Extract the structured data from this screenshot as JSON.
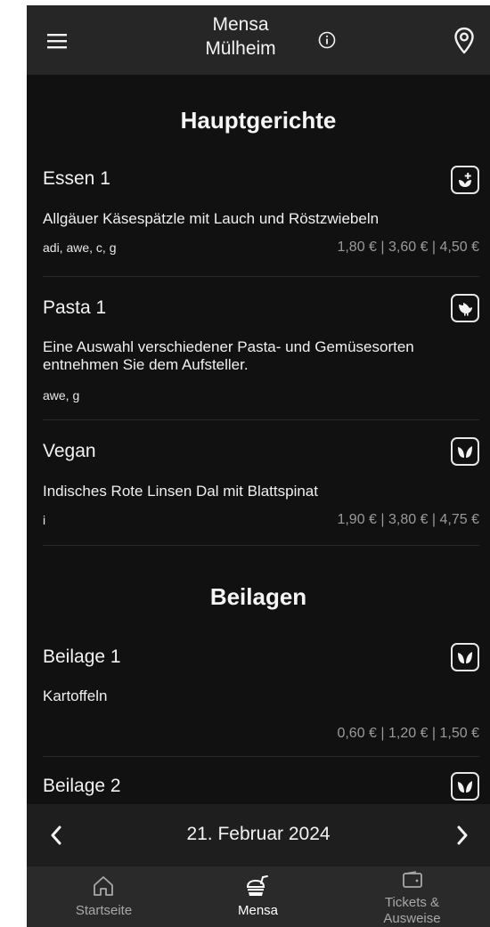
{
  "header": {
    "title_line1": "Mensa",
    "title_line2": "Mülheim",
    "menu_icon": "hamburger-menu-icon",
    "info_icon": "info-icon",
    "location_icon": "location-pin-icon"
  },
  "sections": [
    {
      "title": "Hauptgerichte",
      "meals": [
        {
          "name": "Essen 1",
          "description": "Allgäuer Käsespätzle  mit Lauch und Röstzwiebeln",
          "allergens": "adi, awe, c, g",
          "prices": "1,80 € | 3,60 € | 4,50 €",
          "badge_icon": "vegetarian-icon"
        },
        {
          "name": "Pasta 1",
          "description": "Eine Auswahl verschiedener Pasta- und Gemüsesorten entnehmen Sie dem Aufsteller.",
          "allergens": "awe, g",
          "prices": "",
          "badge_icon": "poultry-icon"
        },
        {
          "name": "Vegan",
          "description": "Indisches Rote Linsen Dal mit Blattspinat",
          "allergens": "i",
          "prices": "1,90 € | 3,80 € | 4,75 €",
          "badge_icon": "vegan-leaf-icon"
        }
      ]
    },
    {
      "title": "Beilagen",
      "meals": [
        {
          "name": "Beilage 1",
          "description": "Kartoffeln",
          "allergens": "",
          "prices": "0,60 € | 1,20 € | 1,50 €",
          "badge_icon": "vegan-leaf-icon"
        },
        {
          "name": "Beilage 2",
          "description": "",
          "allergens": "",
          "prices": "",
          "badge_icon": "vegan-leaf-icon"
        }
      ]
    }
  ],
  "date_nav": {
    "date": "21. Februar 2024",
    "prev_icon": "chevron-left-icon",
    "next_icon": "chevron-right-icon"
  },
  "bottom_nav": [
    {
      "label": "Startseite",
      "icon": "home-icon",
      "active": false
    },
    {
      "label": "Mensa",
      "icon": "fast-food-icon",
      "active": true
    },
    {
      "label": "Tickets &\nAusweise",
      "icon": "wallet-icon",
      "active": false
    }
  ],
  "colors": {
    "background": "#111111",
    "header": "#262626",
    "datebar": "#1e1e1e",
    "bottom_nav": "#2a2a2a",
    "price_text": "#9a9a9a",
    "active_nav": "#ffffff",
    "inactive_nav": "#a8a8a8"
  }
}
